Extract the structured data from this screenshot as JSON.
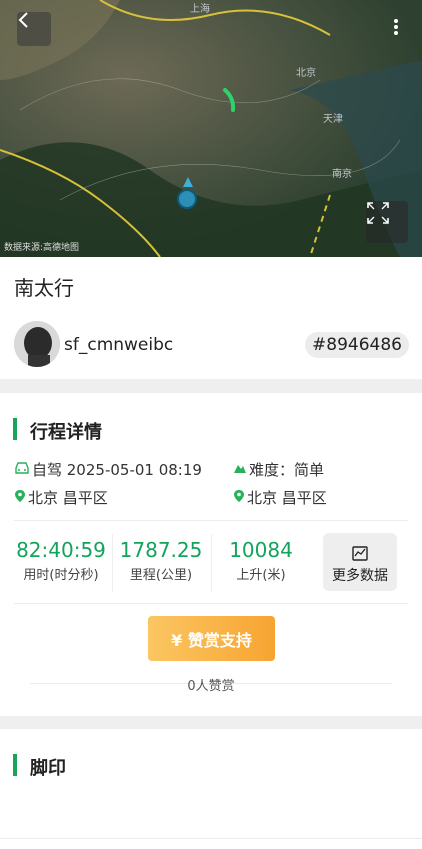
{
  "map": {
    "credit": "数据来源:高德地图",
    "place_labels": [
      "北京",
      "天津",
      "南京",
      "上海"
    ]
  },
  "route": {
    "title": "南太行",
    "username": "sf_cmnweibc",
    "id_badge": "#8946486"
  },
  "detail": {
    "section_title": "行程详情",
    "mode_time": "自驾 2025-05-01 08:19",
    "difficulty": "难度：简单",
    "start_location": "北京 昌平区",
    "end_location": "北京 昌平区",
    "stats": [
      {
        "value": "82:40:59",
        "label": "用时(时分秒)"
      },
      {
        "value": "1787.25",
        "label": "里程(公里)"
      },
      {
        "value": "10084",
        "label": "上升(米)"
      }
    ],
    "more_data_label": "更多数据",
    "reward_button": "¥ 赞赏支持",
    "reward_count": "0人赞赏"
  },
  "footprint": {
    "section_title": "脚印"
  },
  "colors": {
    "accent_green": "#1aa35a",
    "reward_orange": "#f7a431"
  }
}
